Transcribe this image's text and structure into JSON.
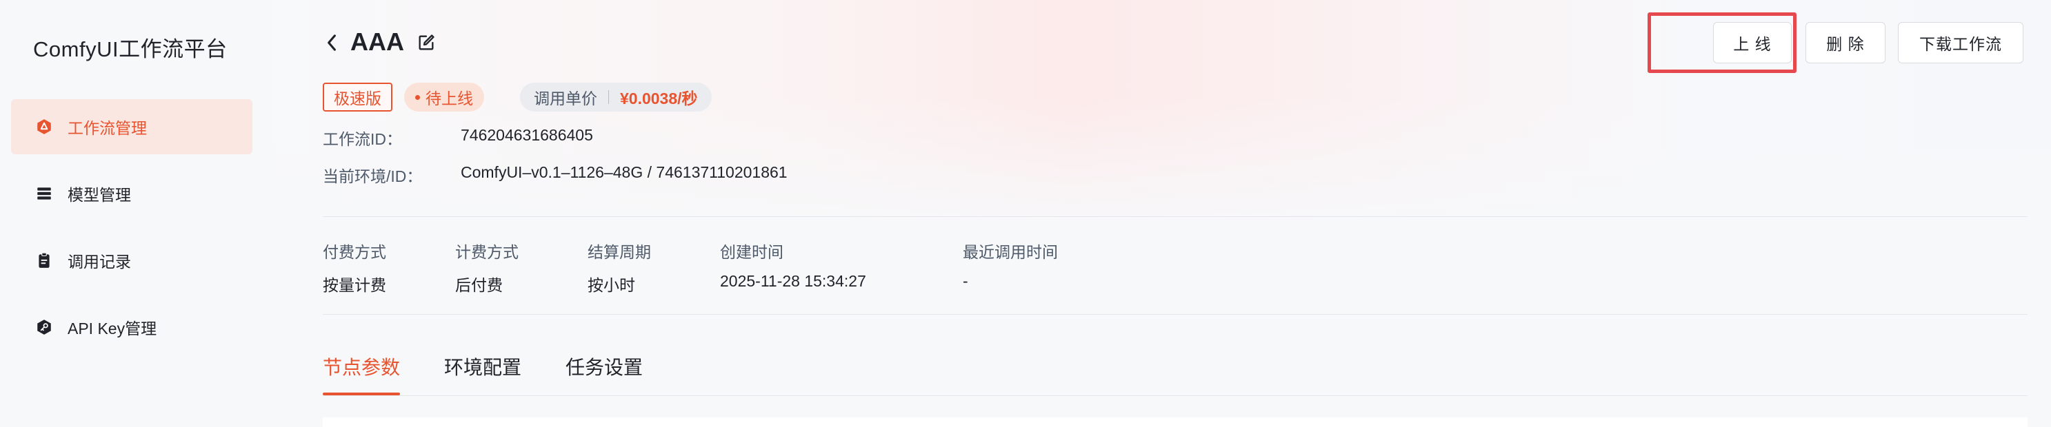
{
  "app": {
    "title": "ComfyUI工作流平台"
  },
  "sidebar": {
    "items": [
      {
        "label": "工作流管理",
        "icon": "workflow-icon",
        "active": true
      },
      {
        "label": "模型管理",
        "icon": "model-stack-icon",
        "active": false
      },
      {
        "label": "调用记录",
        "icon": "clipboard-icon",
        "active": false
      },
      {
        "label": "API Key管理",
        "icon": "key-badge-icon",
        "active": false
      }
    ]
  },
  "header": {
    "back_icon": "chevron-left-icon",
    "title": "AAA",
    "edit_icon": "edit-icon",
    "buttons": {
      "online": "上 线",
      "delete": "删 除",
      "download": "下载工作流"
    }
  },
  "tags": {
    "speed": "极速版",
    "status": "待上线",
    "price_label": "调用单价",
    "price_value": "¥0.0038/秒"
  },
  "info": {
    "workflow_id_label": "工作流ID：",
    "workflow_id_value": "746204631686405",
    "env_label": "当前环境/ID：",
    "env_value": "ComfyUI–v0.1–1126–48G / 746137110201861"
  },
  "meta": {
    "columns": [
      {
        "label": "付费方式",
        "value": "按量计费"
      },
      {
        "label": "计费方式",
        "value": "后付费"
      },
      {
        "label": "结算周期",
        "value": "按小时"
      },
      {
        "label": "创建时间",
        "value": "2025-11-28 15:34:27"
      },
      {
        "label": "最近调用时间",
        "value": "-"
      }
    ]
  },
  "tabs": [
    {
      "label": "节点参数",
      "active": true
    },
    {
      "label": "环境配置",
      "active": false
    },
    {
      "label": "任务设置",
      "active": false
    }
  ],
  "colors": {
    "accent": "#e8542f",
    "highlight": "#e5484d"
  }
}
